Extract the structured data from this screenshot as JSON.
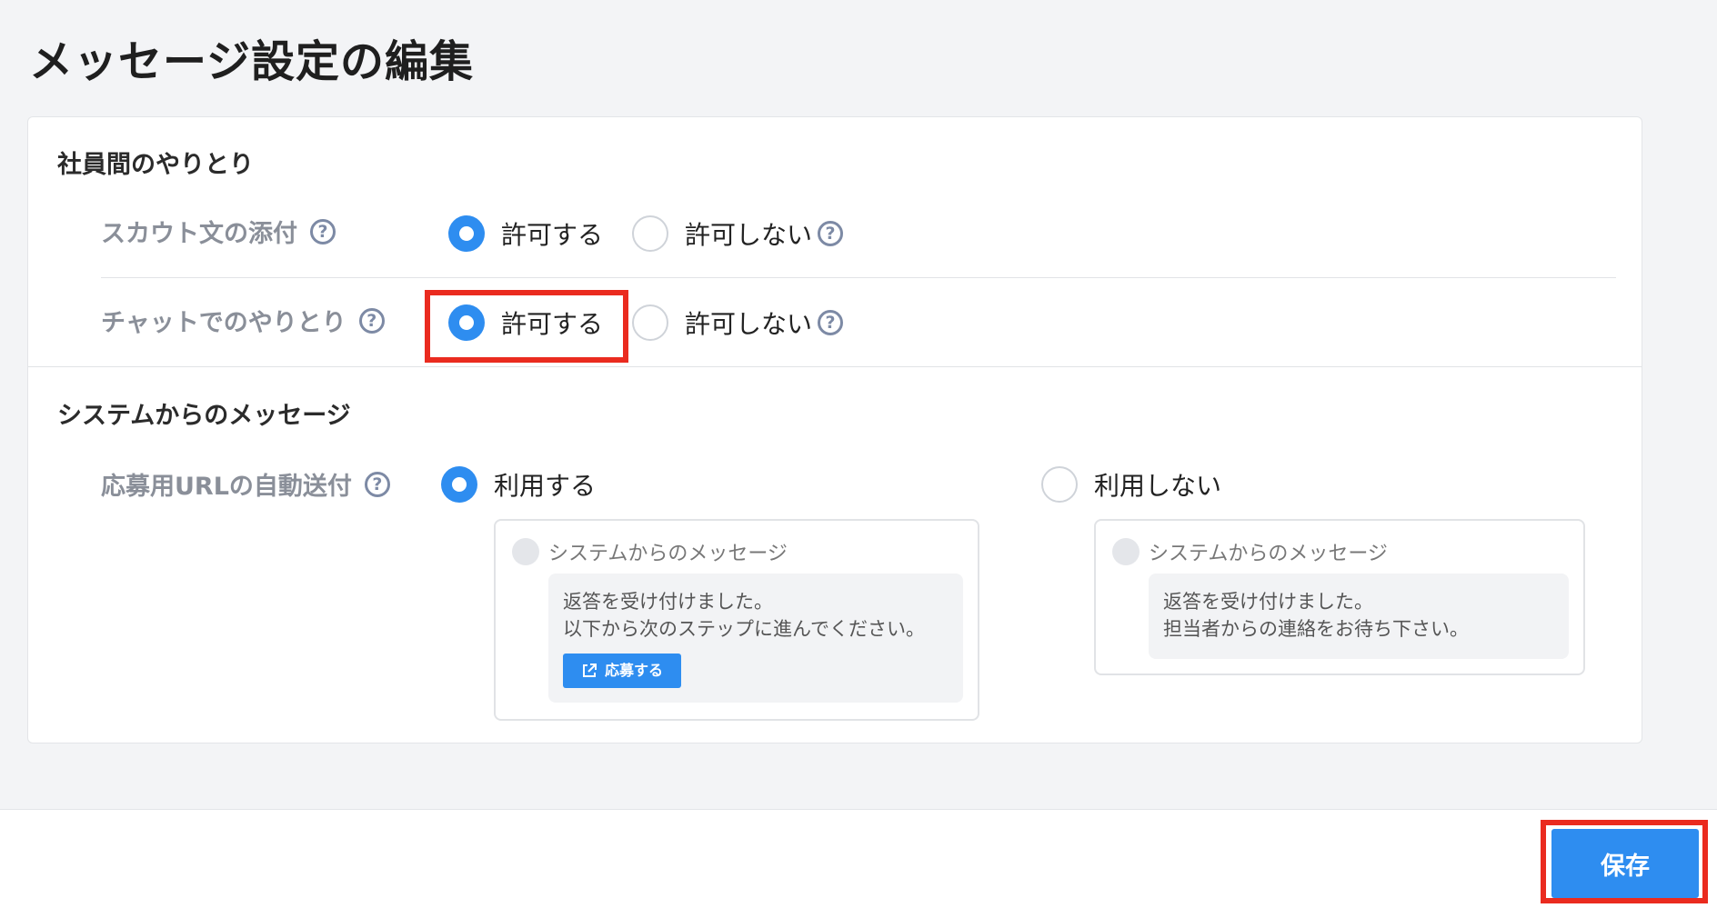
{
  "page_title": "メッセージ設定の編集",
  "sections": {
    "internal": {
      "title": "社員間のやりとり",
      "rows": [
        {
          "label": "スカウト文の添付",
          "help_icon": "question-circle-icon",
          "options": [
            {
              "label": "許可する",
              "checked": true
            },
            {
              "label": "許可しない",
              "checked": false
            }
          ]
        },
        {
          "label": "チャットでのやりとり",
          "help_icon": "question-circle-icon",
          "options": [
            {
              "label": "許可する",
              "checked": true
            },
            {
              "label": "許可しない",
              "checked": false
            }
          ]
        }
      ]
    },
    "system": {
      "title": "システムからのメッセージ",
      "row": {
        "label": "応募用URLの自動送付",
        "help_icon": "question-circle-icon",
        "options": [
          {
            "label": "利用する",
            "checked": true,
            "preview": {
              "sender": "システムからのメッセージ",
              "lines": [
                "返答を受け付けました。",
                "以下から次のステップに進んでください。"
              ],
              "button_label": "応募する",
              "button_icon": "external-link-icon"
            }
          },
          {
            "label": "利用しない",
            "checked": false,
            "preview": {
              "sender": "システムからのメッセージ",
              "lines": [
                "返答を受け付けました。",
                "担当者からの連絡をお待ち下さい。"
              ]
            }
          }
        ]
      }
    }
  },
  "footer": {
    "save_label": "保存"
  },
  "colors": {
    "accent": "#2e8df0",
    "highlight": "#ea2b1f",
    "background": "#f3f4f6",
    "label_gray": "#8a8f99"
  },
  "help_glyph": "?"
}
